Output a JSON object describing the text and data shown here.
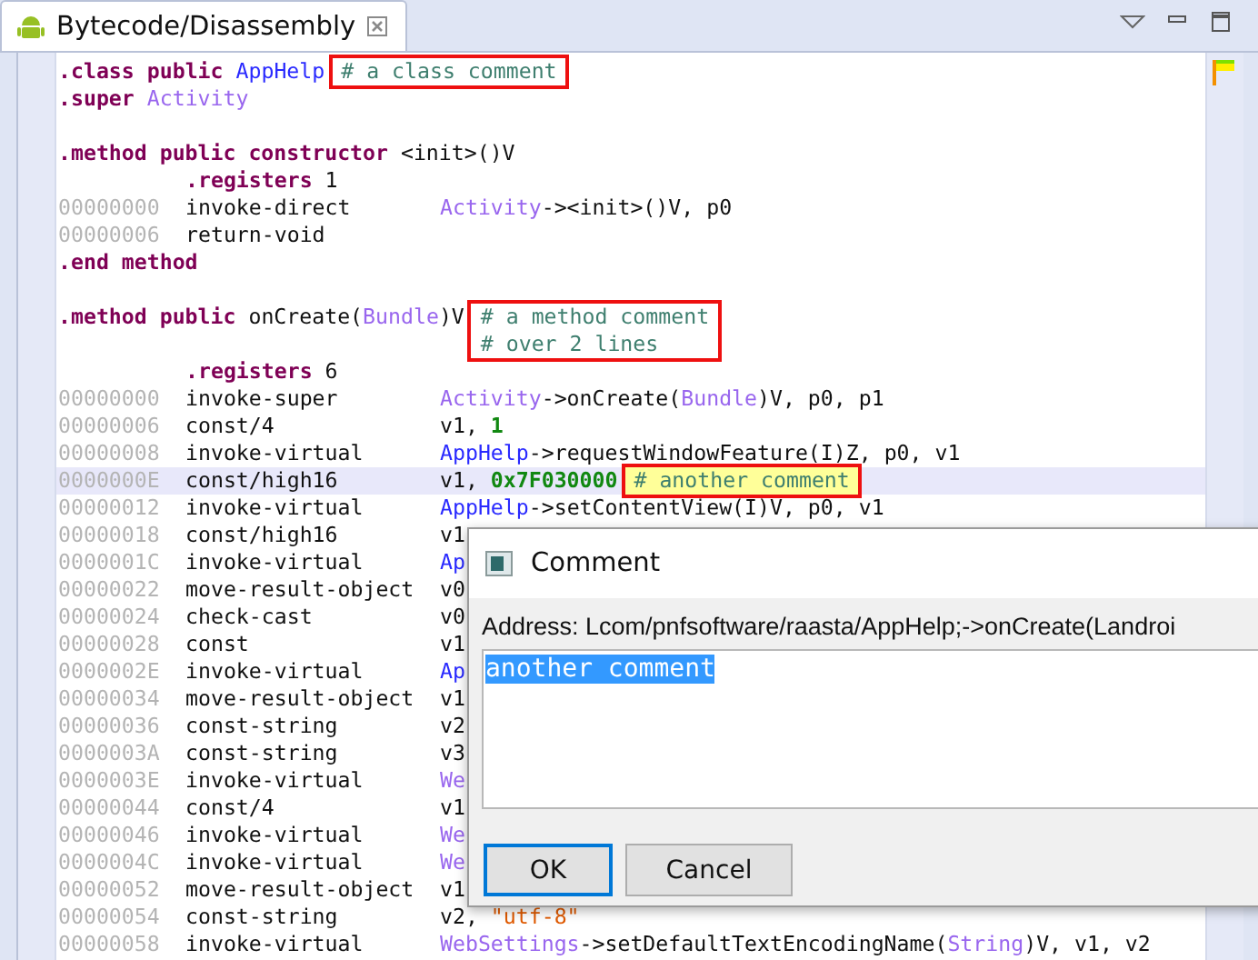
{
  "tab": {
    "title": "Bytecode/Disassembly",
    "selected": true
  },
  "code_lines": [
    {
      "kind": "header",
      "tokens": [
        {
          "kind": "directive",
          "t": ".class "
        },
        {
          "kind": "keyword",
          "t": "public "
        },
        {
          "kind": "type",
          "t": "AppHelp"
        }
      ],
      "comment": [
        "# a class comment"
      ],
      "framed": true,
      "selected": false
    },
    {
      "kind": "header",
      "tokens": [
        {
          "kind": "directive",
          "t": ".super "
        },
        {
          "kind": "ref",
          "t": "Activity"
        }
      ],
      "selected": false
    },
    {
      "kind": "blank",
      "selected": false
    },
    {
      "kind": "header",
      "tokens": [
        {
          "kind": "directive",
          "t": ".method "
        },
        {
          "kind": "keyword",
          "t": "public constructor "
        },
        {
          "kind": "plain",
          "t": "<init>()V"
        }
      ],
      "selected": false
    },
    {
      "kind": "meta",
      "tokens": [
        {
          "kind": "directive",
          "t": ".registers "
        },
        {
          "kind": "plain",
          "t": "1"
        }
      ],
      "selected": false
    },
    {
      "kind": "instruction",
      "address": "00000000",
      "opcode": "invoke-direct",
      "tokens": [
        {
          "kind": "ref",
          "t": "Activity"
        },
        {
          "kind": "plain",
          "t": "-><init>()V, p0"
        }
      ],
      "selected": false
    },
    {
      "kind": "instruction",
      "address": "00000006",
      "opcode": "return-void",
      "selected": false
    },
    {
      "kind": "header",
      "tokens": [
        {
          "kind": "directive",
          "t": ".end method"
        }
      ],
      "selected": false
    },
    {
      "kind": "blank",
      "selected": false
    },
    {
      "kind": "header",
      "tokens": [
        {
          "kind": "directive",
          "t": ".method "
        },
        {
          "kind": "keyword",
          "t": "public "
        },
        {
          "kind": "plain",
          "t": "onCreate("
        },
        {
          "kind": "ref",
          "t": "Bundle"
        },
        {
          "kind": "plain",
          "t": ")V"
        }
      ],
      "comment": [
        "# a method comment",
        "# over 2 lines"
      ],
      "framed": true,
      "selected": false
    },
    {
      "kind": "blank",
      "selected": false
    },
    {
      "kind": "meta",
      "tokens": [
        {
          "kind": "directive",
          "t": ".registers "
        },
        {
          "kind": "plain",
          "t": "6"
        }
      ],
      "selected": false
    },
    {
      "kind": "instruction",
      "address": "00000000",
      "opcode": "invoke-super",
      "tokens": [
        {
          "kind": "ref",
          "t": "Activity"
        },
        {
          "kind": "plain",
          "t": "->onCreate("
        },
        {
          "kind": "ref",
          "t": "Bundle"
        },
        {
          "kind": "plain",
          "t": ")V, p0, p1"
        }
      ],
      "selected": false
    },
    {
      "kind": "instruction",
      "address": "00000006",
      "opcode": "const/4",
      "tokens": [
        {
          "kind": "plain",
          "t": "v1, "
        },
        {
          "kind": "number",
          "t": "1"
        }
      ],
      "selected": false
    },
    {
      "kind": "instruction",
      "address": "00000008",
      "opcode": "invoke-virtual",
      "tokens": [
        {
          "kind": "type",
          "t": "AppHelp"
        },
        {
          "kind": "plain",
          "t": "->requestWindowFeature(I)Z, p0, v1"
        }
      ],
      "selected": false
    },
    {
      "kind": "instruction",
      "address": "0000000E",
      "opcode": "const/high16",
      "tokens": [
        {
          "kind": "plain",
          "t": "v1, "
        },
        {
          "kind": "number",
          "t": "0x7F030000"
        }
      ],
      "comment": [
        "# another comment"
      ],
      "framed": true,
      "selected": true
    },
    {
      "kind": "instruction",
      "address": "00000012",
      "opcode": "invoke-virtual",
      "tokens": [
        {
          "kind": "type",
          "t": "AppHelp"
        },
        {
          "kind": "plain",
          "t": "->setContentView(I)V, p0, v1"
        }
      ],
      "selected": false
    },
    {
      "kind": "instruction",
      "address": "00000018",
      "opcode": "const/high16",
      "tokens": [
        {
          "kind": "plain",
          "t": "v1"
        }
      ],
      "selected": false
    },
    {
      "kind": "instruction",
      "address": "0000001C",
      "opcode": "invoke-virtual",
      "tokens": [
        {
          "kind": "type",
          "t": "Ap"
        }
      ],
      "selected": false
    },
    {
      "kind": "instruction",
      "address": "00000022",
      "opcode": "move-result-object",
      "tokens": [
        {
          "kind": "plain",
          "t": "v0"
        }
      ],
      "selected": false
    },
    {
      "kind": "instruction",
      "address": "00000024",
      "opcode": "check-cast",
      "tokens": [
        {
          "kind": "plain",
          "t": "v0"
        }
      ],
      "selected": false
    },
    {
      "kind": "instruction",
      "address": "00000028",
      "opcode": "const",
      "tokens": [
        {
          "kind": "plain",
          "t": "v1"
        }
      ],
      "selected": false
    },
    {
      "kind": "instruction",
      "address": "0000002E",
      "opcode": "invoke-virtual",
      "tokens": [
        {
          "kind": "type",
          "t": "Ap"
        }
      ],
      "selected": false
    },
    {
      "kind": "instruction",
      "address": "00000034",
      "opcode": "move-result-object",
      "tokens": [
        {
          "kind": "plain",
          "t": "v1"
        }
      ],
      "selected": false
    },
    {
      "kind": "instruction",
      "address": "00000036",
      "opcode": "const-string",
      "tokens": [
        {
          "kind": "plain",
          "t": "v2"
        }
      ],
      "selected": false
    },
    {
      "kind": "instruction",
      "address": "0000003A",
      "opcode": "const-string",
      "tokens": [
        {
          "kind": "plain",
          "t": "v3"
        }
      ],
      "selected": false
    },
    {
      "kind": "instruction",
      "address": "0000003E",
      "opcode": "invoke-virtual",
      "tokens": [
        {
          "kind": "ref",
          "t": "We"
        }
      ],
      "selected": false
    },
    {
      "kind": "instruction",
      "address": "00000044",
      "opcode": "const/4",
      "tokens": [
        {
          "kind": "plain",
          "t": "v1"
        }
      ],
      "selected": false
    },
    {
      "kind": "instruction",
      "address": "00000046",
      "opcode": "invoke-virtual",
      "tokens": [
        {
          "kind": "ref",
          "t": "We"
        }
      ],
      "selected": false
    },
    {
      "kind": "instruction",
      "address": "0000004C",
      "opcode": "invoke-virtual",
      "tokens": [
        {
          "kind": "ref",
          "t": "We"
        }
      ],
      "selected": false
    },
    {
      "kind": "instruction",
      "address": "00000052",
      "opcode": "move-result-object",
      "tokens": [
        {
          "kind": "plain",
          "t": "v1"
        }
      ],
      "selected": false
    },
    {
      "kind": "instruction",
      "address": "00000054",
      "opcode": "const-string",
      "tokens": [
        {
          "kind": "plain",
          "t": "v2, "
        },
        {
          "kind": "string",
          "t": "\"utf-8\""
        }
      ],
      "selected": false
    },
    {
      "kind": "instruction",
      "address": "00000058",
      "opcode": "invoke-virtual",
      "tokens": [
        {
          "kind": "ref",
          "t": "WebSettings"
        },
        {
          "kind": "plain",
          "t": "->setDefaultTextEncodingName("
        },
        {
          "kind": "ref",
          "t": "String"
        },
        {
          "kind": "plain",
          "t": ")V, v1, v2"
        }
      ],
      "selected": false
    }
  ],
  "dialog": {
    "title": "Comment",
    "address": "Address: Lcom/pnfsoftware/raasta/AppHelp;->onCreate(Landroi",
    "value": "another comment",
    "buttons": [
      {
        "label": "OK",
        "default": true
      },
      {
        "label": "Cancel",
        "default": false
      }
    ]
  }
}
